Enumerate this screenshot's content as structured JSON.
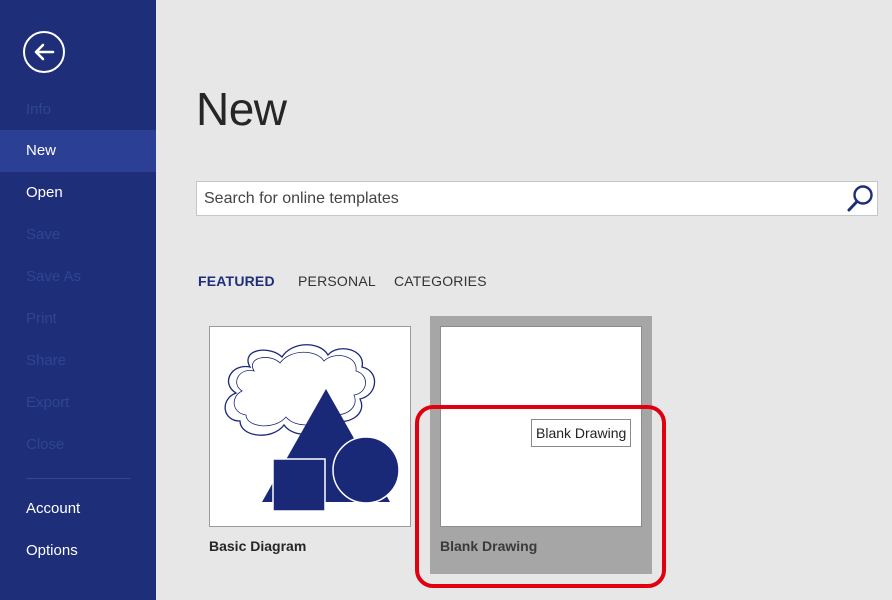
{
  "sidebar": {
    "back_label": "Back",
    "items": [
      {
        "label": "Info",
        "state": "disabled"
      },
      {
        "label": "New",
        "state": "active"
      },
      {
        "label": "Open",
        "state": "enabled"
      },
      {
        "label": "Save",
        "state": "disabled"
      },
      {
        "label": "Save As",
        "state": "disabled"
      },
      {
        "label": "Print",
        "state": "disabled"
      },
      {
        "label": "Share",
        "state": "disabled"
      },
      {
        "label": "Export",
        "state": "disabled"
      },
      {
        "label": "Close",
        "state": "disabled"
      }
    ],
    "bottom_items": [
      {
        "label": "Account"
      },
      {
        "label": "Options"
      }
    ]
  },
  "main": {
    "title": "New",
    "search": {
      "placeholder": "Search for online templates",
      "value": ""
    },
    "tabs": [
      {
        "label": "FEATURED",
        "active": true
      },
      {
        "label": "PERSONAL",
        "active": false
      },
      {
        "label": "CATEGORIES",
        "active": false
      }
    ],
    "templates": [
      {
        "label": "Basic Diagram"
      },
      {
        "label": "Blank Drawing",
        "tooltip": "Blank Drawing",
        "hovered": true
      }
    ]
  },
  "colors": {
    "sidebar_bg": "#1e2e78",
    "sidebar_active": "#2b3f95",
    "accent": "#1e2e78",
    "highlight": "#e0000f",
    "shape_fill": "#1a2878"
  },
  "icons": {
    "back": "back-arrow-icon",
    "search": "magnifier-icon"
  }
}
